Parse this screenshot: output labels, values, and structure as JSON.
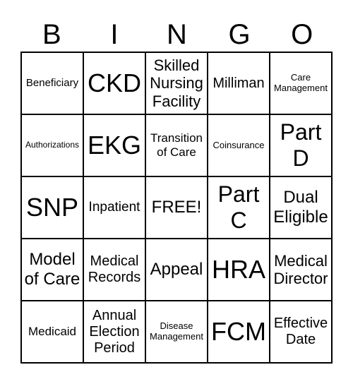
{
  "header": [
    "B",
    "I",
    "N",
    "G",
    "O"
  ],
  "cells": [
    "Beneficiary",
    "CKD",
    "Skilled Nursing Facility",
    "Milliman",
    "Care Management",
    "Authorizations",
    "EKG",
    "Transition of Care",
    "Coinsurance",
    "Part D",
    "SNP",
    "Inpatient",
    "FREE!",
    "Part C",
    "Dual Eligible",
    "Model of Care",
    "Medical Records",
    "Appeal",
    "HRA",
    "Medical Director",
    "Medicaid",
    "Annual Election Period",
    "Disease Management",
    "FCM",
    "Effective Date"
  ]
}
